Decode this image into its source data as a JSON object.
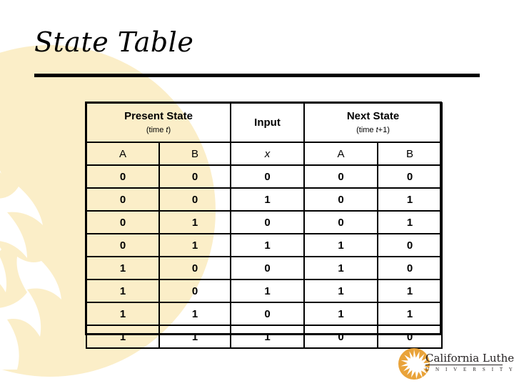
{
  "slide": {
    "title": "State Table"
  },
  "table": {
    "group_headers": [
      {
        "label": "Present State",
        "sub_prefix": "(time ",
        "sub_var": "t",
        "sub_suffix": ")",
        "colspan": 2
      },
      {
        "label": "Input",
        "sub_prefix": "",
        "sub_var": "",
        "sub_suffix": "",
        "colspan": 1
      },
      {
        "label": "Next State",
        "sub_prefix": "(time ",
        "sub_var": "t",
        "sub_suffix": "+1)",
        "colspan": 2
      }
    ],
    "column_headers": [
      "A",
      "B",
      "x",
      "A",
      "B"
    ],
    "rows": [
      [
        "0",
        "0",
        "0",
        "0",
        "0"
      ],
      [
        "0",
        "0",
        "1",
        "0",
        "1"
      ],
      [
        "0",
        "1",
        "0",
        "0",
        "1"
      ],
      [
        "0",
        "1",
        "1",
        "1",
        "0"
      ],
      [
        "1",
        "0",
        "0",
        "1",
        "0"
      ],
      [
        "1",
        "0",
        "1",
        "1",
        "1"
      ],
      [
        "1",
        "1",
        "0",
        "1",
        "1"
      ],
      [
        "1",
        "1",
        "1",
        "0",
        "0"
      ]
    ]
  },
  "logo": {
    "name": "California Lutheran",
    "university": "U N I V E R S I T Y",
    "icon": "sun-burst-icon"
  },
  "colors": {
    "sun_fill": "#fbeec8",
    "sun_fill_light": "#fdf6e3",
    "logo_gold": "#e9a33a",
    "rule": "#000000",
    "text": "#000000"
  },
  "decor": {
    "background_icon": "sun-burst-background-icon"
  }
}
